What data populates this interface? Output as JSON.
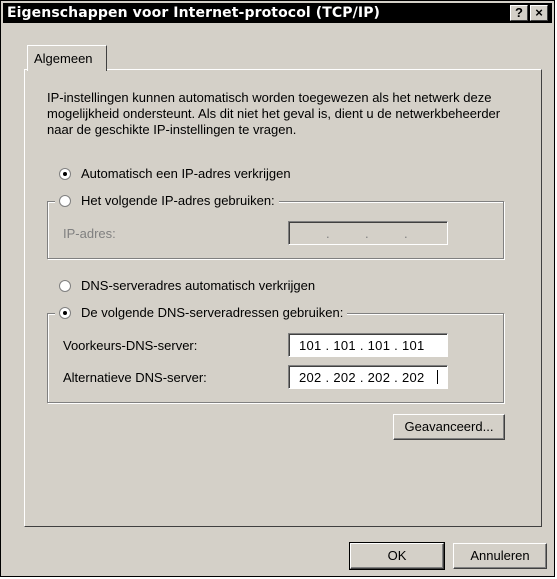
{
  "window": {
    "title": "Eigenschappen voor Internet-protocol (TCP/IP)",
    "help_button": "?",
    "close_button": "×"
  },
  "tabs": [
    {
      "label": "Algemeen",
      "active": true
    }
  ],
  "intro": "IP-instellingen kunnen automatisch worden toegewezen als het netwerk deze mogelijkheid ondersteunt. Als dit niet het geval is, dient u de netwerkbeheerder naar de geschikte IP-instellingen te vragen.",
  "ip": {
    "auto_label": "Automatisch een IP-adres verkrijgen",
    "manual_label": "Het volgende IP-adres gebruiken:",
    "selected": "auto",
    "address_label": "IP-adres:",
    "address_value": ""
  },
  "dns": {
    "auto_label": "DNS-serveradres automatisch verkrijgen",
    "manual_label": "De volgende DNS-serveradressen gebruiken:",
    "selected": "manual",
    "preferred_label": "Voorkeurs-DNS-server:",
    "preferred_value": "101 . 101 . 101 . 101",
    "alternate_label": "Alternatieve DNS-server:",
    "alternate_value": "202 . 202 . 202 . 202"
  },
  "buttons": {
    "advanced": "Geavanceerd...",
    "ok": "OK",
    "cancel": "Annuleren"
  }
}
